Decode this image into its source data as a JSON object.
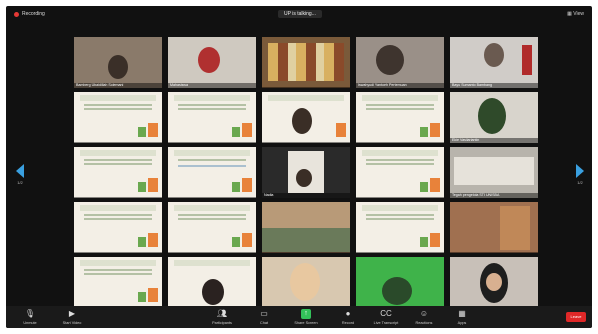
{
  "topbar": {
    "recording_label": "Recording",
    "speaking_label": "UP is talking...",
    "view_label": "View"
  },
  "participants": [
    {
      "name": "Bamberg Ubaidillah Solemani"
    },
    {
      "name": "Mahasiswa"
    },
    {
      "name": ""
    },
    {
      "name": "Iswahyudi Yantoeh Pertemuan"
    },
    {
      "name": "Bayu Sumanto Bambang"
    },
    {
      "name": ""
    },
    {
      "name": ""
    },
    {
      "name": ""
    },
    {
      "name": ""
    },
    {
      "name": "Ekie Vasiiariantin"
    },
    {
      "name": ""
    },
    {
      "name": ""
    },
    {
      "name": "Nadia"
    },
    {
      "name": ""
    },
    {
      "name": "Tegah pengelola STI UNISBA"
    },
    {
      "name": ""
    },
    {
      "name": ""
    },
    {
      "name": ""
    },
    {
      "name": ""
    },
    {
      "name": ""
    },
    {
      "name": ""
    },
    {
      "name": ""
    },
    {
      "name": ""
    },
    {
      "name": ""
    },
    {
      "name": ""
    }
  ],
  "nav": {
    "left_page": "1/2",
    "right_page": "1/2"
  },
  "toolbar": {
    "unmute": "Unmute",
    "start_video": "Start Video",
    "participants": "Participants",
    "participants_count": "42",
    "chat": "Chat",
    "share_screen": "Share Screen",
    "record": "Record",
    "live_transcript": "Live Transcript",
    "reactions": "Reactions",
    "apps": "Apps",
    "end": "Leave"
  },
  "colors": {
    "accent": "#3aa0e0",
    "share_green": "#33c15a",
    "end_red": "#e02828"
  }
}
